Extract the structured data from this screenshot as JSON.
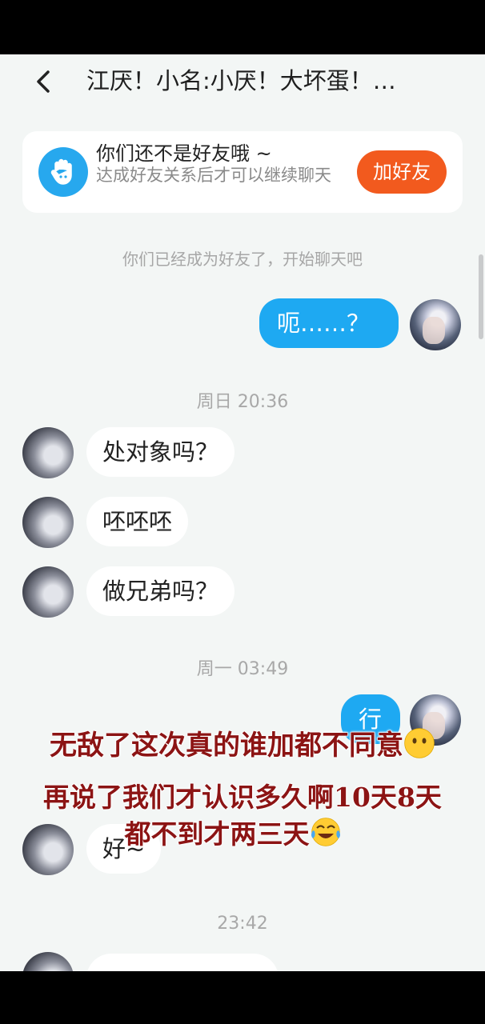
{
  "header": {
    "title": "江厌！小名:小厌！大坏蛋！…"
  },
  "banner": {
    "title": "你们还不是好友哦 ~",
    "subtitle": "达成好友关系后才可以继续聊天",
    "button": "加好友"
  },
  "system_notice": "你们已经成为好友了，开始聊天吧",
  "messages": {
    "m1": "呃……？",
    "t1": "周日 20:36",
    "m2": "处对象吗？",
    "m3": "呸呸呸",
    "m4": "做兄弟吗？",
    "t2": "周一 03:49",
    "m5": "行",
    "m6": "好~",
    "t3": "23:42"
  },
  "overlay": {
    "line1": "无敌了这次真的谁加都不同意",
    "line2": "再说了我们才认识多久啊10天8天",
    "line3": "都不到才两三天",
    "emoji1": "neutral-face-emoji",
    "emoji2": "tears-of-joy-emoji"
  },
  "colors": {
    "accent_blue": "#1ea9f2",
    "add_button": "#f25a1e",
    "overlay_text": "#8c1414"
  }
}
